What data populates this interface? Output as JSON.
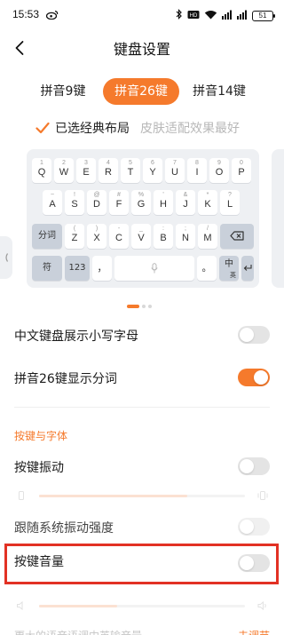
{
  "status_bar": {
    "time": "15:53",
    "network": "HD",
    "battery": "51"
  },
  "header": {
    "title": "键盘设置"
  },
  "tabs": [
    {
      "label": "拼音9键",
      "selected": false
    },
    {
      "label": "拼音26键",
      "selected": true
    },
    {
      "label": "拼音14键",
      "selected": false
    }
  ],
  "layout": {
    "selected_label": "已选经典布局",
    "hint": "皮肤适配效果最好"
  },
  "keyboard": {
    "row1": [
      {
        "sym": "1",
        "key": "Q"
      },
      {
        "sym": "2",
        "key": "W"
      },
      {
        "sym": "3",
        "key": "E"
      },
      {
        "sym": "4",
        "key": "R"
      },
      {
        "sym": "5",
        "key": "T"
      },
      {
        "sym": "6",
        "key": "Y"
      },
      {
        "sym": "7",
        "key": "U"
      },
      {
        "sym": "8",
        "key": "I"
      },
      {
        "sym": "9",
        "key": "O"
      },
      {
        "sym": "0",
        "key": "P"
      }
    ],
    "row2": [
      {
        "sym": "~",
        "key": "A"
      },
      {
        "sym": "!",
        "key": "S"
      },
      {
        "sym": "@",
        "key": "D"
      },
      {
        "sym": "#",
        "key": "F"
      },
      {
        "sym": "%",
        "key": "G"
      },
      {
        "sym": "'",
        "key": "H"
      },
      {
        "sym": "&",
        "key": "J"
      },
      {
        "sym": "*",
        "key": "K"
      },
      {
        "sym": "?",
        "key": "L"
      }
    ],
    "row3_left": "分词",
    "row3": [
      {
        "sym": "(",
        "key": "Z"
      },
      {
        "sym": ")",
        "key": "X"
      },
      {
        "sym": "-",
        "key": "C"
      },
      {
        "sym": "_",
        "key": "V"
      },
      {
        "sym": ":",
        "key": "B"
      },
      {
        "sym": ";",
        "key": "N"
      },
      {
        "sym": "/",
        "key": "M"
      }
    ],
    "row4_symbol": "符",
    "row4_number": "123",
    "row4_comma": "，",
    "row4_period": "。",
    "row4_lang": "中",
    "row4_lang_sub": "英"
  },
  "settings": {
    "show_lowercase": {
      "label": "中文键盘展示小写字母",
      "on": false
    },
    "show_segment": {
      "label": "拼音26键显示分词",
      "on": true
    },
    "section_keys_font": "按键与字体",
    "key_vibration": {
      "label": "按键振动",
      "on": false
    },
    "follow_system_vibration": {
      "label": "跟随系统振动强度",
      "on": false
    },
    "key_sound": {
      "label": "按键音量",
      "on": false
    },
    "bottom_partial_label": "更大的语音语调中英输音量",
    "bottom_partial_link": "去调节"
  },
  "colors": {
    "accent": "#f57a2c",
    "highlight": "#e23124",
    "keyboard_bg": "#eef0f3",
    "function_key": "#c9d0da"
  }
}
